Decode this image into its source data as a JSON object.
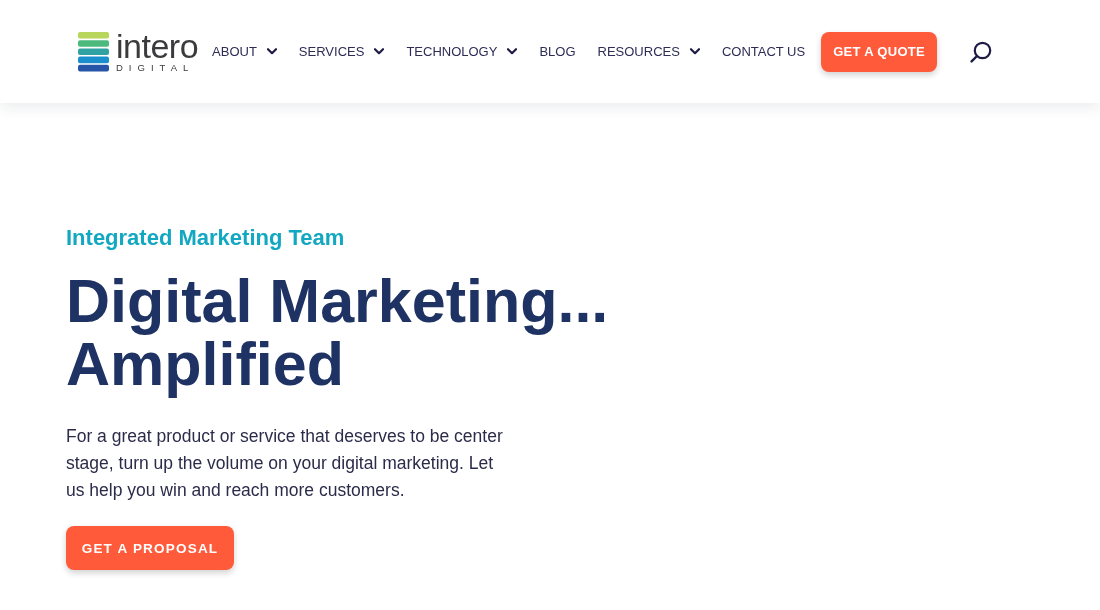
{
  "header": {
    "logo": {
      "wordmark": "intero",
      "tagline": "DIGITAL"
    },
    "nav": [
      {
        "label": "ABOUT",
        "has_dropdown": true
      },
      {
        "label": "SERVICES",
        "has_dropdown": true
      },
      {
        "label": "TECHNOLOGY",
        "has_dropdown": true
      },
      {
        "label": "BLOG",
        "has_dropdown": false
      },
      {
        "label": "RESOURCES",
        "has_dropdown": true
      },
      {
        "label": "CONTACT US",
        "has_dropdown": false
      }
    ],
    "cta_button": "GET A QUOTE"
  },
  "hero": {
    "eyebrow": "Integrated Marketing Team",
    "headline": "Digital Marketing... Amplified",
    "paragraph": "For a great product or service that deserves to be center stage, turn up the volume on your digital marketing. Let us help you win and reach more customers.",
    "button": "GET A PROPOSAL"
  }
}
